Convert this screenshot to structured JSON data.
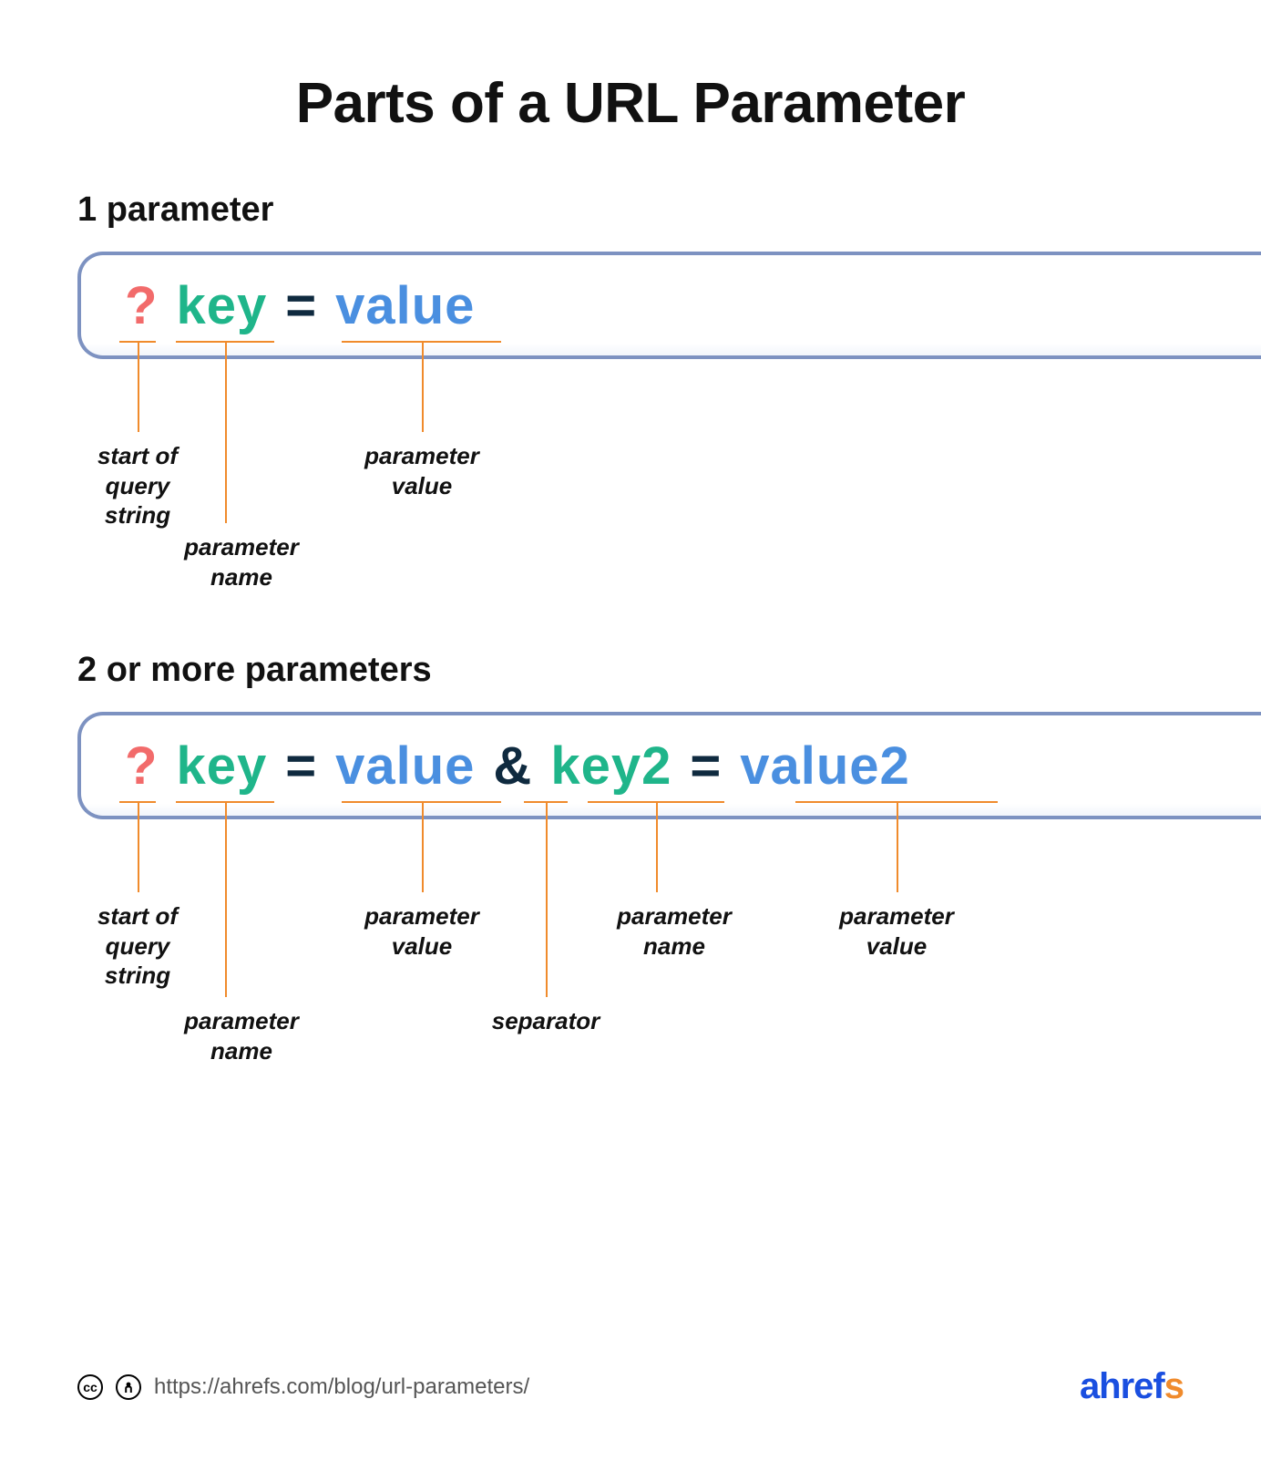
{
  "title": "Parts of a URL Parameter",
  "section1": {
    "label": "1 parameter",
    "tokens": {
      "q": "?",
      "key": "key",
      "eq": "=",
      "value": "value"
    },
    "callouts": {
      "start_of_query_string": "start of\nquery\nstring",
      "parameter_name": "parameter\nname",
      "parameter_value": "parameter\nvalue"
    }
  },
  "section2": {
    "label": "2 or more parameters",
    "tokens": {
      "q": "?",
      "key": "key",
      "eq": "=",
      "value": "value",
      "amp": "&",
      "key2": "key2",
      "eq2": "=",
      "value2": "value2"
    },
    "callouts": {
      "start_of_query_string": "start of\nquery\nstring",
      "parameter_name": "parameter\nname",
      "parameter_value": "parameter\nvalue",
      "separator": "separator",
      "parameter_name2": "parameter\nname",
      "parameter_value2": "parameter\nvalue"
    }
  },
  "footer": {
    "url": "https://ahrefs.com/blog/url-parameters/",
    "brand_main": "ahref",
    "brand_end": "s"
  },
  "colors": {
    "red": "#f26b6b",
    "teal": "#1fb58a",
    "dark": "#0f2a3f",
    "blue": "#4a8fe0",
    "orange": "#f08b2c",
    "bar_border": "#7d92c1"
  }
}
